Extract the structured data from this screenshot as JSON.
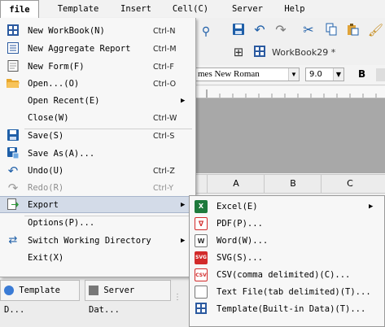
{
  "menubar": {
    "items": [
      "file",
      "Template",
      "Insert",
      "Cell(C)",
      "Server",
      "Help"
    ]
  },
  "file_menu": {
    "items": [
      {
        "label": "New WorkBook(N)",
        "shortcut": "Ctrl-N",
        "icon": "workbook-icon"
      },
      {
        "label": "New Aggregate Report",
        "shortcut": "Ctrl-M",
        "icon": "aggregate-report-icon"
      },
      {
        "label": "New Form(F)",
        "shortcut": "Ctrl-F",
        "icon": "form-icon"
      },
      {
        "label": "Open...(O)",
        "shortcut": "Ctrl-O",
        "icon": "folder-icon"
      },
      {
        "label": "Open Recent(E)",
        "shortcut": "",
        "icon": ""
      },
      {
        "label": "Close(W)",
        "shortcut": "Ctrl-W",
        "icon": ""
      },
      {
        "label": "Save(S)",
        "shortcut": "Ctrl-S",
        "icon": "save-icon"
      },
      {
        "label": "Save As(A)...",
        "shortcut": "",
        "icon": "save-as-icon"
      },
      {
        "label": "Undo(U)",
        "shortcut": "Ctrl-Z",
        "icon": "undo-icon"
      },
      {
        "label": "Redo(R)",
        "shortcut": "Ctrl-Y",
        "icon": "redo-icon"
      },
      {
        "label": "Export",
        "shortcut": "",
        "icon": "export-icon"
      },
      {
        "label": "Options(P)...",
        "shortcut": "",
        "icon": ""
      },
      {
        "label": "Switch Working Directory",
        "shortcut": "",
        "icon": "switch-icon"
      },
      {
        "label": "Exit(X)",
        "shortcut": "",
        "icon": ""
      }
    ]
  },
  "export_menu": {
    "items": [
      {
        "label": "Excel(E)",
        "icon": "excel-icon"
      },
      {
        "label": "PDF(P)...",
        "icon": "pdf-icon"
      },
      {
        "label": "Word(W)...",
        "icon": "word-icon"
      },
      {
        "label": "SVG(S)...",
        "icon": "svg-icon"
      },
      {
        "label": "CSV(comma delimited)(C)...",
        "icon": "csv-icon"
      },
      {
        "label": "Text File(tab delimited)(T)...",
        "icon": "text-file-icon"
      },
      {
        "label": "Template(Built-in Data)(T)...",
        "icon": "template-icon"
      }
    ]
  },
  "toolbar": {
    "workbook_tab": "WorkBook29 *",
    "font_name": "mes New Roman",
    "font_size": "9.0",
    "bold_label": "B"
  },
  "grid": {
    "columns": [
      "A",
      "B",
      "C"
    ]
  },
  "bottom_tabs": [
    "Template D...",
    "Server Dat..."
  ],
  "colors": {
    "highlight": "#d3dbe8",
    "canvas": "#a8a8a8",
    "save_blue": "#1f5fa8",
    "excel_green": "#1e7a3c",
    "pdf_red": "#d22a2a"
  }
}
